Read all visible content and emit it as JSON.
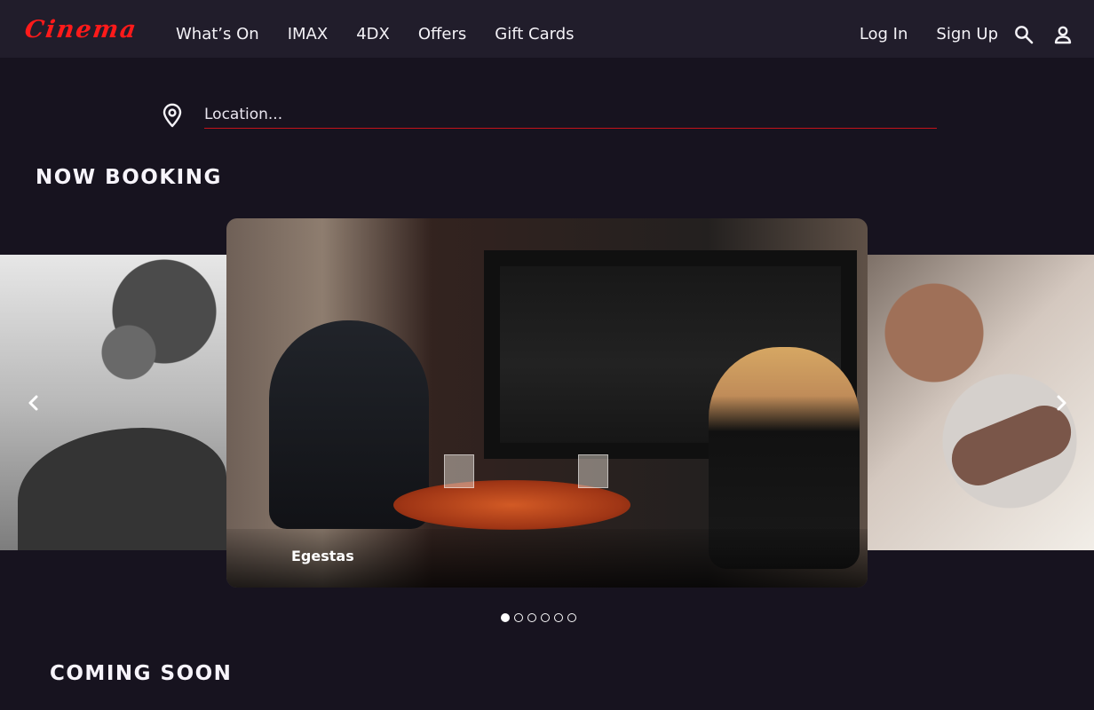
{
  "brand": {
    "logo_text": "Cinema",
    "logo_color": "#ff1a1a"
  },
  "nav": {
    "items": [
      {
        "label": "What’s On"
      },
      {
        "label": "IMAX"
      },
      {
        "label": "4DX"
      },
      {
        "label": "Offers"
      },
      {
        "label": "Gift Cards"
      }
    ]
  },
  "account": {
    "login_label": "Log In",
    "signup_label": "Sign Up",
    "search_icon": "search-icon",
    "profile_icon": "profile-icon"
  },
  "location": {
    "placeholder": "Location...",
    "icon": "location-pin-icon",
    "underline_color": "#c4131b"
  },
  "sections": {
    "now_booking": "NOW BOOKING",
    "coming_soon": "COMING SOON"
  },
  "carousel": {
    "featured_title": "Egestas",
    "active_index": 1,
    "total_slides": 6,
    "prev_icon": "chevron-left-icon",
    "next_icon": "chevron-right-icon"
  },
  "colors": {
    "page_background": "#17131f",
    "header_background": "#211d2b",
    "accent_red": "#ff1a1a"
  }
}
